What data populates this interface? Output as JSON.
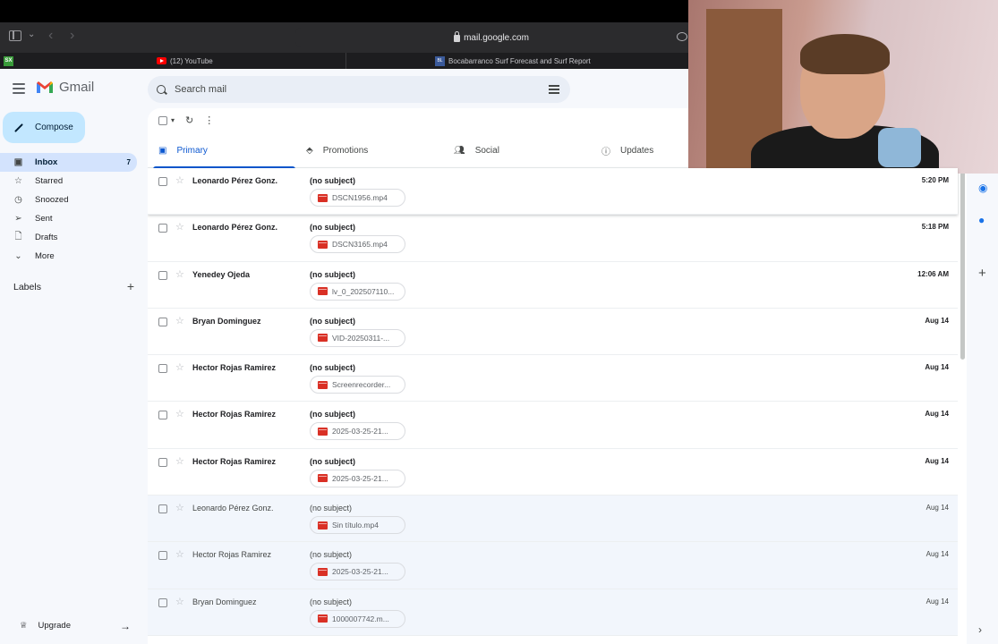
{
  "browser": {
    "url": "mail.google.com",
    "tabs": [
      {
        "label": "(12) YouTube",
        "icon": "youtube-icon"
      },
      {
        "label": "Bocabarranco Surf Forecast and Surf Report",
        "icon": "surf-forecast-icon"
      }
    ],
    "pinned_badge": "SX"
  },
  "app": {
    "wordmark": "Gmail",
    "search_placeholder": "Search mail",
    "compose_label": "Compose",
    "labels_heading": "Labels",
    "upgrade_label": "Upgrade"
  },
  "nav": [
    {
      "label": "Inbox",
      "icon": "inbox-icon",
      "count": "7",
      "active": true
    },
    {
      "label": "Starred",
      "icon": "star-icon"
    },
    {
      "label": "Snoozed",
      "icon": "clock-icon"
    },
    {
      "label": "Sent",
      "icon": "send-icon"
    },
    {
      "label": "Drafts",
      "icon": "draft-icon"
    },
    {
      "label": "More",
      "icon": "chevron-down-icon"
    }
  ],
  "category_tabs": [
    {
      "label": "Primary",
      "icon": "inbox-icon",
      "active": true
    },
    {
      "label": "Promotions",
      "icon": "tag-icon"
    },
    {
      "label": "Social",
      "icon": "people-icon"
    },
    {
      "label": "Updates",
      "icon": "info-icon"
    }
  ],
  "emails": [
    {
      "sender": "Leonardo Pérez Gonz.",
      "subject": "(no subject)",
      "attachment": "DSCN1956.mp4",
      "date": "5:20 PM",
      "unread": true
    },
    {
      "sender": "Leonardo Pérez Gonz.",
      "subject": "(no subject)",
      "attachment": "DSCN3165.mp4",
      "date": "5:18 PM",
      "unread": true
    },
    {
      "sender": "Yenedey Ojeda",
      "subject": "(no subject)",
      "attachment": "lv_0_202507110...",
      "date": "12:06 AM",
      "unread": true
    },
    {
      "sender": "Bryan Dominguez",
      "subject": "(no subject)",
      "attachment": "VID-20250311-...",
      "date": "Aug 14",
      "unread": true
    },
    {
      "sender": "Hector Rojas Ramirez",
      "subject": "(no subject)",
      "attachment": "Screenrecorder...",
      "date": "Aug 14",
      "unread": true
    },
    {
      "sender": "Hector Rojas Ramirez",
      "subject": "(no subject)",
      "attachment": "2025-03-25-21...",
      "date": "Aug 14",
      "unread": true
    },
    {
      "sender": "Hector Rojas Ramirez",
      "subject": "(no subject)",
      "attachment": "2025-03-25-21...",
      "date": "Aug 14",
      "unread": true
    },
    {
      "sender": "Leonardo Pérez Gonz.",
      "subject": "(no subject)",
      "attachment": "Sin título.mp4",
      "date": "Aug 14",
      "unread": false
    },
    {
      "sender": "Hector Rojas Ramirez",
      "subject": "(no subject)",
      "attachment": "2025-03-25-21...",
      "date": "Aug 14",
      "unread": false
    },
    {
      "sender": "Bryan Dominguez",
      "subject": "(no subject)",
      "attachment": "1000007742.m...",
      "date": "Aug 14",
      "unread": false
    }
  ],
  "colors": {
    "accent": "#0b57d0",
    "compose_bg": "#c2e7ff",
    "active_nav_bg": "#d3e3fd",
    "video_attachment": "#d93025"
  }
}
